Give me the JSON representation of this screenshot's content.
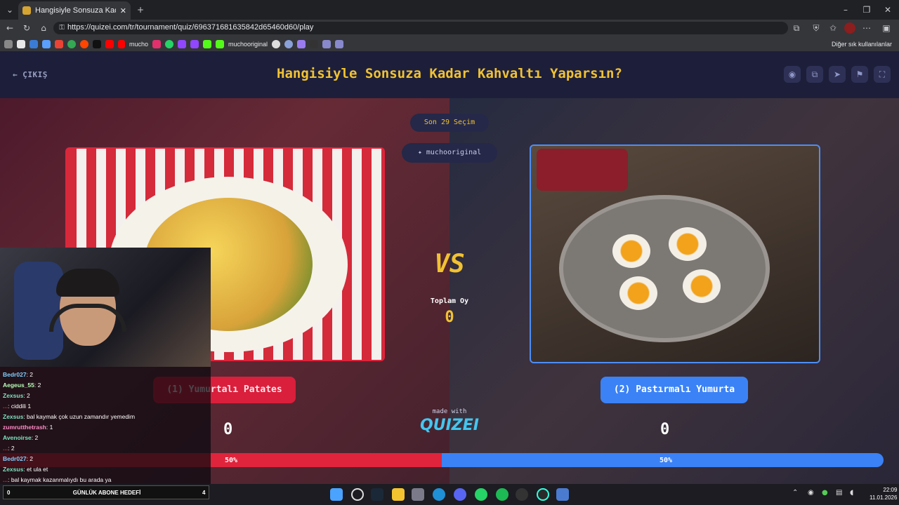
{
  "browser": {
    "tab_title": "Hangisiyle Sonsuza Kadar Kahvaltı",
    "url": "https://quizei.com/tr/tournament/quiz/696371681635842d65460d60/play",
    "bookmarks": [
      "mucho",
      "muchooriginal",
      "Diğer sık kullanılanlar"
    ]
  },
  "header": {
    "exit_label": "ÇIKIŞ",
    "title": "Hangisiyle Sonsuza Kadar Kahvaltı Yaparsın?"
  },
  "round": {
    "last_label": "Son 29 Seçim",
    "user": "muchooriginal",
    "vs": "VS",
    "total_votes_label": "Toplam Oy",
    "total_votes": "0",
    "made_with": "made with",
    "brand": "QUIZEI"
  },
  "left": {
    "label": "(1) Yumurtalı Patates",
    "votes": "0",
    "percent_text": "50%",
    "percent": 50,
    "color": "#e0243c"
  },
  "right": {
    "label": "(2) Pastırmalı Yumurta",
    "votes": "0",
    "percent_text": "50%",
    "percent": 50,
    "color": "#3b82f6"
  },
  "chat": [
    {
      "user": "Bedr027",
      "msg": ": 2",
      "color": "#7fd0ff"
    },
    {
      "user": "Aegeus_55",
      "msg": ": 2",
      "color": "#b8ffb8"
    },
    {
      "user": "Zexsus",
      "msg": ": 2",
      "color": "#7fe3c0"
    },
    {
      "user": "...",
      "msg": ": ciddili 1",
      "color": "#e0243c"
    },
    {
      "user": "Zexsus",
      "msg": ": bal kaymak çok uzun zamandır yemedim",
      "color": "#7fe3c0"
    },
    {
      "user": "zumrutthetrash",
      "msg": ": 1",
      "color": "#ff8ac8"
    },
    {
      "user": "Avenoirse",
      "msg": ": 2",
      "color": "#7fe3c0"
    },
    {
      "user": "...",
      "msg": ": 2",
      "color": "#e0243c"
    },
    {
      "user": "Bedr027",
      "msg": ": 2",
      "color": "#7fd0ff"
    },
    {
      "user": "Zexsus",
      "msg": ": et ula et",
      "color": "#7fe3c0"
    },
    {
      "user": "...",
      "msg": ": bal kaymak kazanmalıydı bu arada ya",
      "color": "#e0243c"
    }
  ],
  "goal": {
    "left": "0",
    "label": "GÜNLÜK ABONE HEDEFİ",
    "right": "4"
  },
  "clock": {
    "time": "22:09",
    "date": "11.01.2026"
  }
}
